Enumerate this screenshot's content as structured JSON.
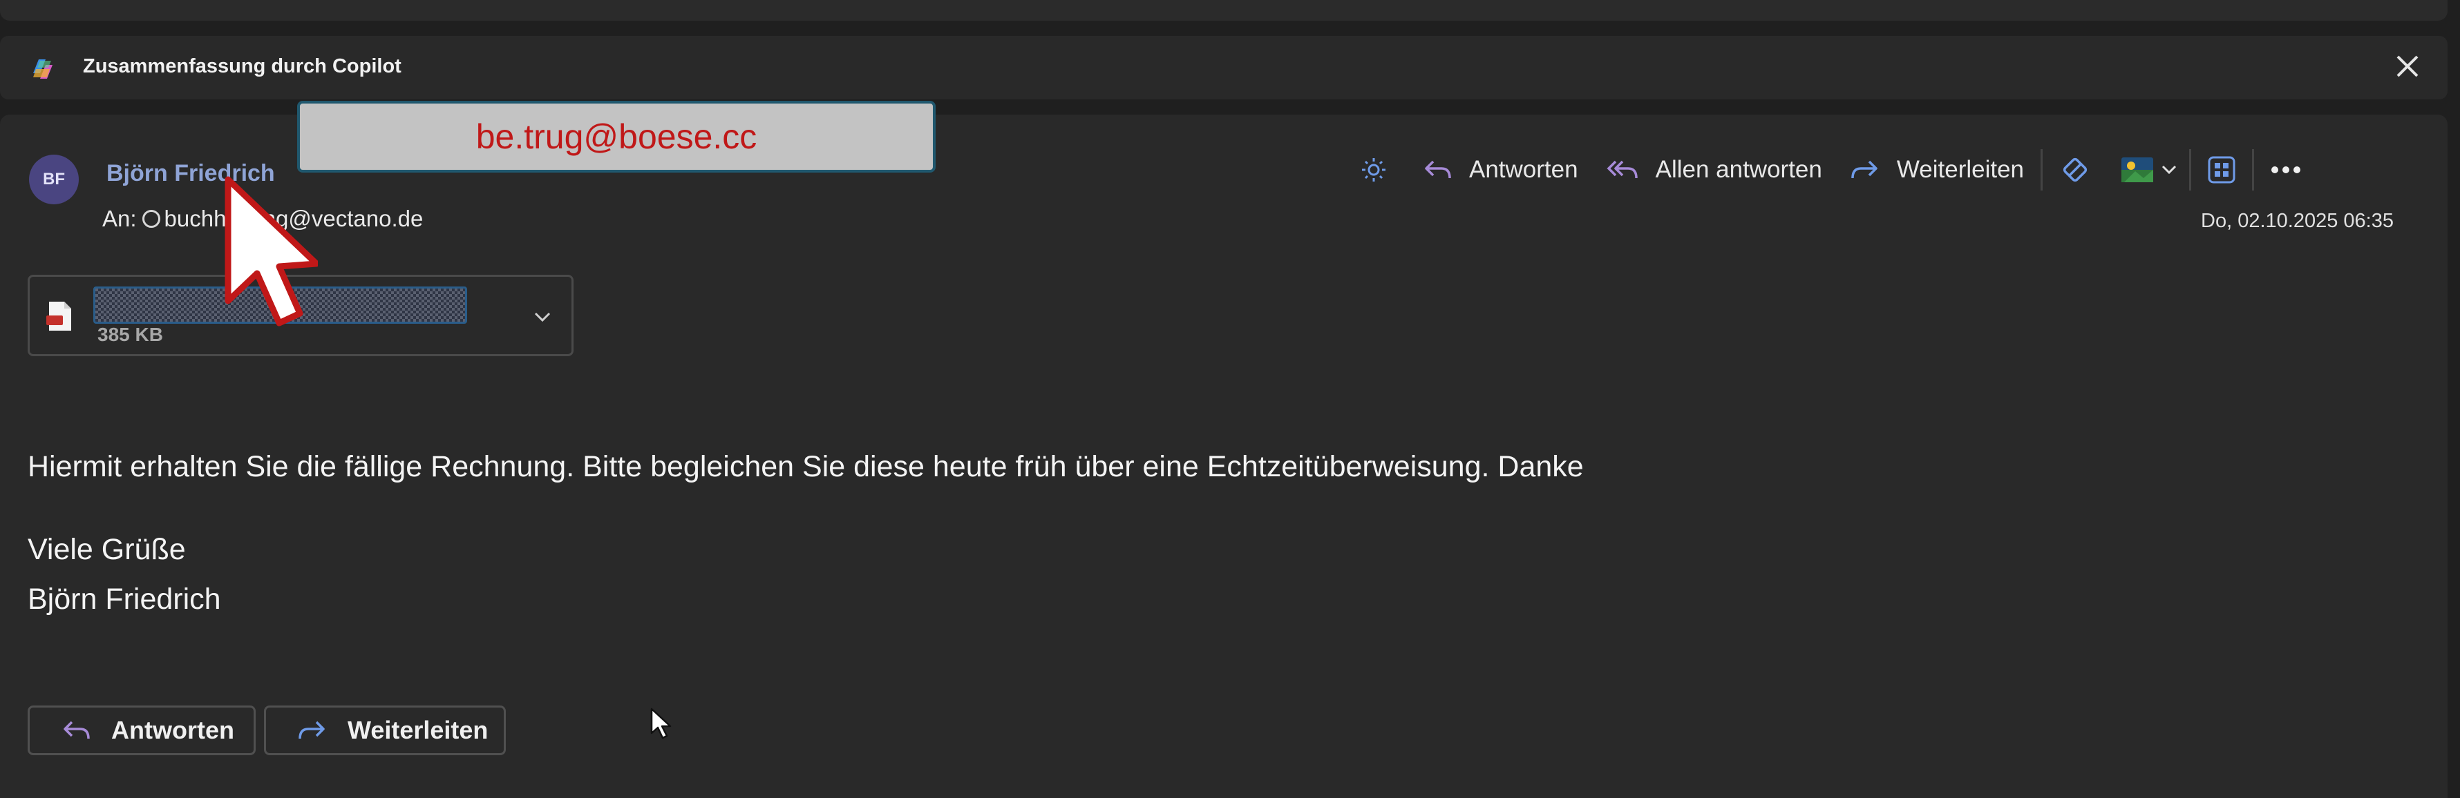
{
  "copilot_bar": {
    "title": "Zusammenfassung durch Copilot"
  },
  "message": {
    "avatar_initials": "BF",
    "sender_name": "Björn Friedrich",
    "to_label": "An:",
    "to_address": "buchhaltung@vectano.de",
    "date": "Do, 02.10.2025 06:35",
    "attachment": {
      "size": "385 KB"
    },
    "body": {
      "line1": "Hiermit erhalten Sie die fällige Rechnung. Bitte begleichen Sie diese heute früh über eine Echtzeitüberweisung. Danke",
      "greeting": "Viele Grüße",
      "signature": "Björn Friedrich"
    }
  },
  "toolbar": {
    "reply": "Antworten",
    "reply_all": "Allen antworten",
    "forward": "Weiterleiten"
  },
  "footer_buttons": {
    "reply": "Antworten",
    "forward": "Weiterleiten"
  },
  "tooltip": {
    "email": "be.trug@boese.cc"
  },
  "colors": {
    "sender_link": "#8fa4d6",
    "accent_purple": "#a78bd8",
    "accent_blue": "#6f9be8",
    "tooltip_text": "#c01818"
  }
}
